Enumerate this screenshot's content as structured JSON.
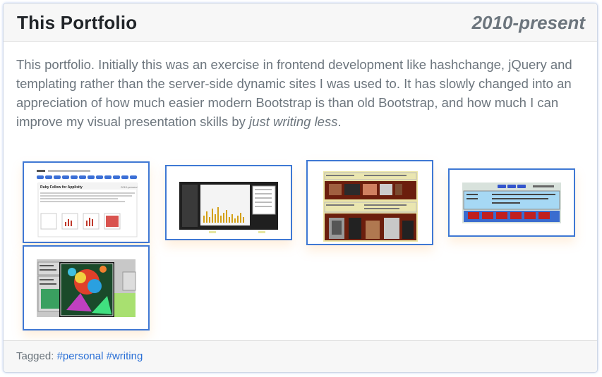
{
  "project": {
    "title": "This Portfolio",
    "dates": "2010-present",
    "description_main": "This portfolio. Initially this was an exercise in frontend development like hashchange, jQuery and templating rather than the server-side dynamic sites I was used to. It has slowly changed into an appreciation of how much easier modern Bootstrap is than old Bootstrap, and how much I can improve my visual presentation skills by ",
    "description_emphasis": "just writing less",
    "description_end": ".",
    "thumb1": {
      "heading": "Ruby Fellow for Applixity",
      "dates": "2016-present"
    }
  },
  "footer": {
    "tagged_label": "Tagged:",
    "tags": [
      "#personal",
      "#writing"
    ]
  },
  "colors": {
    "accent": "#3f78d4",
    "muted_text": "#6c757d",
    "title_text": "#212529",
    "header_bg": "#f7f7f7"
  }
}
